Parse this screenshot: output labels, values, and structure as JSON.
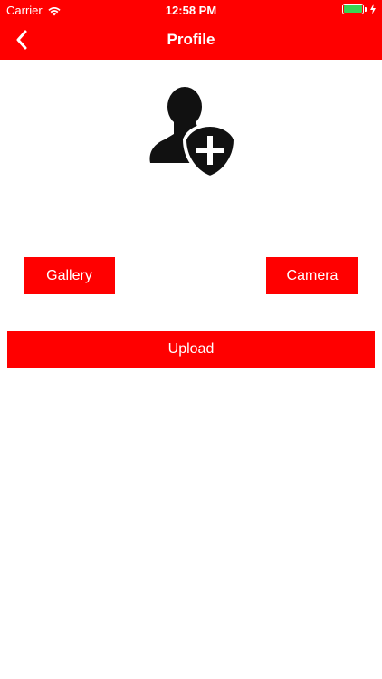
{
  "status_bar": {
    "carrier": "Carrier",
    "time": "12:58 PM",
    "battery_level": 1.0,
    "icons": [
      "wifi-icon",
      "battery-icon",
      "charging-bolt-icon"
    ]
  },
  "nav": {
    "title": "Profile",
    "back_icon": "chevron-left-icon"
  },
  "avatar": {
    "icon": "add-user-icon"
  },
  "buttons": {
    "gallery": "Gallery",
    "camera": "Camera",
    "upload": "Upload"
  },
  "colors": {
    "accent": "#ff0000",
    "on_accent": "#ffffff",
    "background": "#ffffff",
    "icon": "#111111",
    "battery": "#39d353"
  }
}
